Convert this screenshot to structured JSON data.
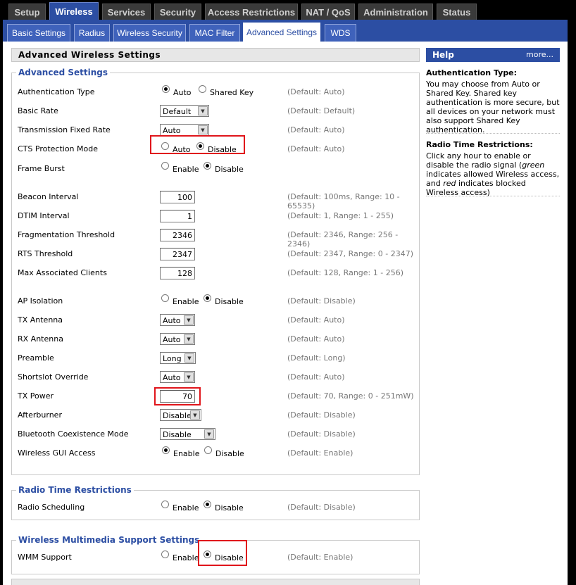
{
  "top_tabs": [
    "Setup",
    "Wireless",
    "Services",
    "Security",
    "Access Restrictions",
    "NAT / QoS",
    "Administration",
    "Status"
  ],
  "sub_tabs": [
    "Basic Settings",
    "Radius",
    "Wireless Security",
    "MAC Filter",
    "Advanced Settings",
    "WDS"
  ],
  "main_title": "Advanced Wireless Settings",
  "advanced": {
    "legend": "Advanced Settings",
    "auth_type": {
      "label": "Authentication Type",
      "opt1": "Auto",
      "opt2": "Shared Key",
      "default": "(Default: Auto)"
    },
    "basic_rate": {
      "label": "Basic Rate",
      "value": "Default",
      "default": "(Default: Default)"
    },
    "tx_rate": {
      "label": "Transmission Fixed Rate",
      "value": "Auto",
      "default": "(Default: Auto)"
    },
    "cts": {
      "label": "CTS Protection Mode",
      "opt1": "Auto",
      "opt2": "Disable",
      "default": "(Default: Auto)"
    },
    "frame_burst": {
      "label": "Frame Burst",
      "opt1": "Enable",
      "opt2": "Disable"
    },
    "beacon": {
      "label": "Beacon Interval",
      "value": "100",
      "default": "(Default: 100ms, Range: 10 - 65535)"
    },
    "dtim": {
      "label": "DTIM Interval",
      "value": "1",
      "default": "(Default: 1, Range: 1 - 255)"
    },
    "frag": {
      "label": "Fragmentation Threshold",
      "value": "2346",
      "default": "(Default: 2346, Range: 256 - 2346)"
    },
    "rts": {
      "label": "RTS Threshold",
      "value": "2347",
      "default": "(Default: 2347, Range: 0 - 2347)"
    },
    "max_clients": {
      "label": "Max Associated Clients",
      "value": "128",
      "default": "(Default: 128, Range: 1 - 256)"
    },
    "ap_isolation": {
      "label": "AP Isolation",
      "opt1": "Enable",
      "opt2": "Disable",
      "default": "(Default: Disable)"
    },
    "tx_antenna": {
      "label": "TX Antenna",
      "value": "Auto",
      "default": "(Default: Auto)"
    },
    "rx_antenna": {
      "label": "RX Antenna",
      "value": "Auto",
      "default": "(Default: Auto)"
    },
    "preamble": {
      "label": "Preamble",
      "value": "Long",
      "default": "(Default: Long)"
    },
    "shortslot": {
      "label": "Shortslot Override",
      "value": "Auto",
      "default": "(Default: Auto)"
    },
    "tx_power": {
      "label": "TX Power",
      "value": "70",
      "default": "(Default: 70, Range: 0 - 251mW)"
    },
    "afterburner": {
      "label": "Afterburner",
      "value": "Disable",
      "default": "(Default: Disable)"
    },
    "bluetooth": {
      "label": "Bluetooth Coexistence Mode",
      "value": "Disable",
      "default": "(Default: Disable)"
    },
    "gui_access": {
      "label": "Wireless GUI Access",
      "opt1": "Enable",
      "opt2": "Disable",
      "default": "(Default: Enable)"
    }
  },
  "radio_time": {
    "legend": "Radio Time Restrictions",
    "scheduling": {
      "label": "Radio Scheduling",
      "opt1": "Enable",
      "opt2": "Disable",
      "default": "(Default: Disable)"
    }
  },
  "wmm": {
    "legend": "Wireless Multimedia Support Settings",
    "support": {
      "label": "WMM Support",
      "opt1": "Enable",
      "opt2": "Disable",
      "default": "(Default: Enable)"
    }
  },
  "help": {
    "title": "Help",
    "more": "more...",
    "auth_title": "Authentication Type:",
    "auth_text": "You may choose from Auto or Shared Key. Shared key authentication is more secure, but all devices on your network must also support Shared Key authentication.",
    "radio_title": "Radio Time Restrictions:",
    "radio_text_1": "Click any hour to enable or disable the radio signal (",
    "radio_green": "green",
    "radio_text_2": " indicates allowed Wireless access, and ",
    "radio_red": "red",
    "radio_text_3": " indicates blocked Wireless access)"
  }
}
